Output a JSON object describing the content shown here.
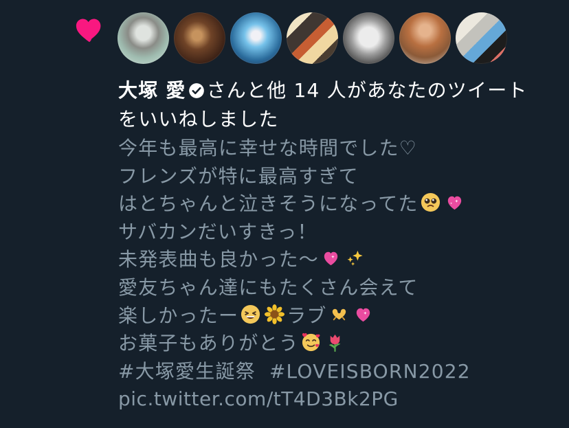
{
  "notification": {
    "icon": "heart-icon",
    "heart_color": "#f91880",
    "avatars": [
      {
        "name": "avatar-1"
      },
      {
        "name": "avatar-2"
      },
      {
        "name": "avatar-3"
      },
      {
        "name": "avatar-4"
      },
      {
        "name": "avatar-5"
      },
      {
        "name": "avatar-6"
      },
      {
        "name": "avatar-7"
      }
    ],
    "liker_name": "大塚 愛",
    "verified_icon": "verified-badge-icon",
    "liked_text_part1": "さんと他 14 人があなたのツイート",
    "liked_text_part2": "をいいねしました"
  },
  "tweet": {
    "lines": [
      "今年も最高に幸せな時間でした♡",
      "フレンズが特に最高すぎて",
      "はとちゃんと泣きそうになってた",
      "サバカンだいすきっ！",
      "未発表曲も良かった〜",
      "愛友ちゃん達にもたくさん会えて",
      "楽しかったー",
      "ラブ",
      "お菓子もありがとう"
    ],
    "hashtags": [
      "#大塚愛生誕祭",
      "#LOVEISBORN2022"
    ],
    "link": "pic.twitter.com/tT4D3Bk2PG"
  },
  "colors": {
    "background": "#15202b",
    "primary_text": "#ffffff",
    "secondary_text": "#8899a6"
  }
}
